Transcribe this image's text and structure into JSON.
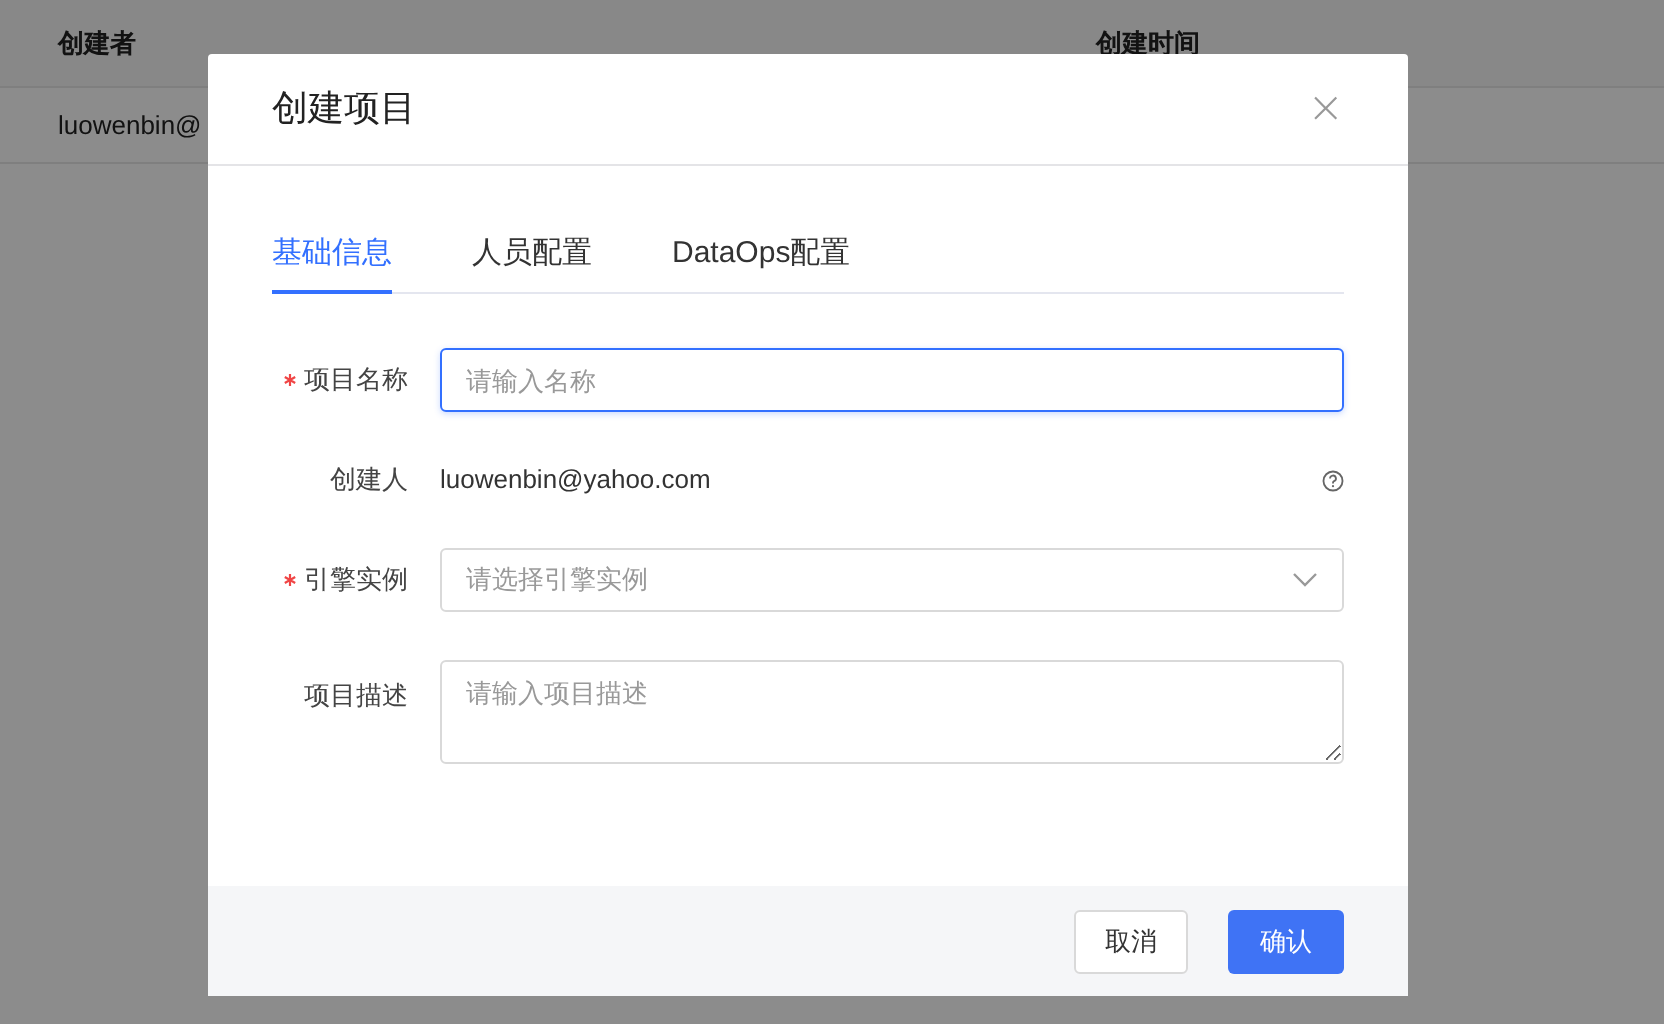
{
  "background_table": {
    "columns": [
      "创建者",
      "创建时间"
    ],
    "rows": [
      [
        "luowenbin@"
      ]
    ]
  },
  "dialog": {
    "title": "创建项目",
    "close": "×",
    "tabs": [
      {
        "label": "基础信息",
        "selected": true
      },
      {
        "label": "人员配置",
        "selected": false
      },
      {
        "label": "DataOps配置",
        "selected": false
      }
    ],
    "fields": [
      {
        "kind": "input",
        "label": "项目名称",
        "required": true,
        "placeholder": "请输入名称",
        "focused": true
      },
      {
        "kind": "text",
        "label": "创建人",
        "required": false,
        "value": "luowenbin@yahoo.com",
        "help": true
      },
      {
        "kind": "select",
        "label": "引擎实例",
        "required": true,
        "placeholder": "请选择引擎实例"
      },
      {
        "kind": "textarea",
        "label": "项目描述",
        "required": false,
        "placeholder": "请输入项目描述"
      }
    ],
    "buttons": [
      {
        "label": "取消",
        "kind": "default"
      },
      {
        "label": "确认",
        "kind": "primary"
      }
    ]
  }
}
